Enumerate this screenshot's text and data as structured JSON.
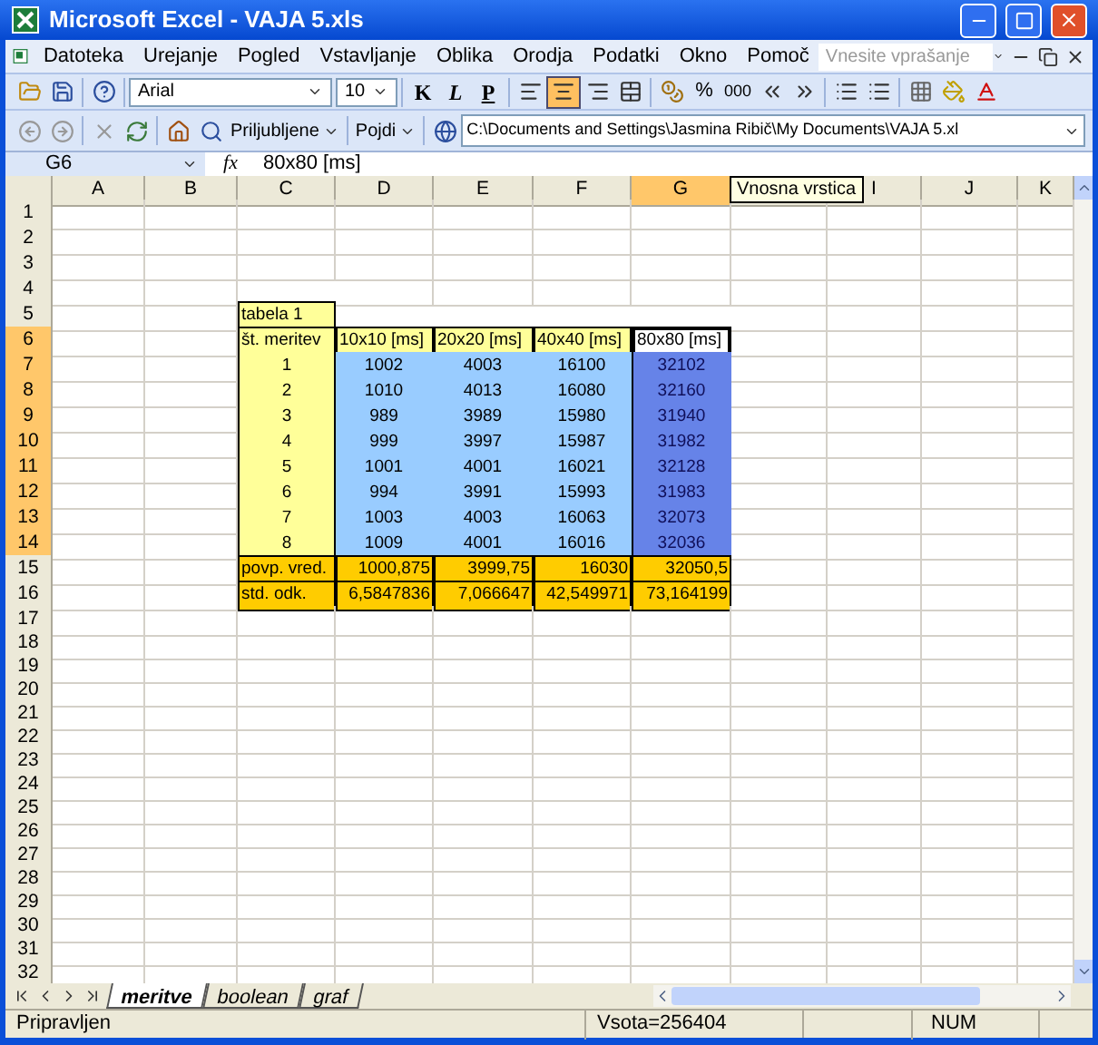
{
  "window": {
    "title": "Microsoft Excel - VAJA 5.xls"
  },
  "menu": [
    "Datoteka",
    "Urejanje",
    "Pogled",
    "Vstavljanje",
    "Oblika",
    "Orodja",
    "Podatki",
    "Okno",
    "Pomoč"
  ],
  "help_search": {
    "placeholder": "Vnesite vprašanje"
  },
  "formatting_toolbar": {
    "font": "Arial",
    "size": "10",
    "bold": "K",
    "italic": "L",
    "underline": "P",
    "percent": "%",
    "thousands": "000",
    "alignments": [
      {
        "kind": "left",
        "selected": false
      },
      {
        "kind": "center",
        "selected": true
      },
      {
        "kind": "right",
        "selected": false
      }
    ]
  },
  "web_toolbar": {
    "favorites": "Priljubljene",
    "go": "Pojdi",
    "address": "C:\\Documents and Settings\\Jasmina Ribič\\My Documents\\VAJA 5.xl"
  },
  "formula_bar": {
    "name_box": "G6",
    "function_label": "fx",
    "content": "80x80 [ms]"
  },
  "tooltip": "Vnosna vrstica",
  "columns": [
    {
      "label": "A",
      "selected": false
    },
    {
      "label": "B",
      "selected": false
    },
    {
      "label": "C",
      "selected": false
    },
    {
      "label": "D",
      "selected": false
    },
    {
      "label": "E",
      "selected": false
    },
    {
      "label": "F",
      "selected": false
    },
    {
      "label": "G",
      "selected": true
    },
    {
      "selected": false
    },
    {
      "label": "I",
      "selected": false
    },
    {
      "label": "J",
      "selected": false
    },
    {
      "label": "K",
      "selected": false
    }
  ],
  "rows": [
    {
      "label": "1",
      "selected": false
    },
    {
      "label": "2",
      "selected": false
    },
    {
      "label": "3",
      "selected": false
    },
    {
      "label": "4",
      "selected": false
    },
    {
      "label": "5",
      "selected": false
    },
    {
      "label": "6",
      "selected": true
    },
    {
      "label": "7",
      "selected": true
    },
    {
      "label": "8",
      "selected": true
    },
    {
      "label": "9",
      "selected": true
    },
    {
      "label": "10",
      "selected": true
    },
    {
      "label": "11",
      "selected": true
    },
    {
      "label": "12",
      "selected": true
    },
    {
      "label": "13",
      "selected": true
    },
    {
      "label": "14",
      "selected": true
    },
    {
      "label": "15",
      "selected": false
    },
    {
      "label": "16",
      "selected": false
    },
    {
      "label": "17",
      "selected": false
    },
    {
      "label": "18",
      "selected": false
    },
    {
      "label": "19",
      "selected": false
    },
    {
      "label": "20",
      "selected": false
    },
    {
      "label": "21",
      "selected": false
    },
    {
      "label": "22",
      "selected": false
    },
    {
      "label": "23",
      "selected": false
    },
    {
      "label": "24",
      "selected": false
    },
    {
      "label": "25",
      "selected": false
    },
    {
      "label": "26",
      "selected": false
    },
    {
      "label": "27",
      "selected": false
    },
    {
      "label": "28",
      "selected": false
    },
    {
      "label": "29",
      "selected": false
    },
    {
      "label": "30",
      "selected": false
    },
    {
      "label": "31",
      "selected": false
    },
    {
      "label": "32",
      "selected": false
    }
  ],
  "table": {
    "title": "tabela 1",
    "label_header": "št. meritev",
    "row_labels": [
      "1",
      "2",
      "3",
      "4",
      "5",
      "6",
      "7",
      "8"
    ],
    "summary_labels": [
      "povp. vred.",
      "std. odk."
    ],
    "columns": [
      {
        "header": "10x10 [ms]",
        "selected": false,
        "values": [
          "1002",
          "1010",
          "989",
          "999",
          "1001",
          "994",
          "1003",
          "1009"
        ],
        "summary": [
          "1000,875",
          "6,5847836"
        ]
      },
      {
        "header": "20x20 [ms]",
        "selected": false,
        "values": [
          "4003",
          "4013",
          "3989",
          "3997",
          "4001",
          "3991",
          "4003",
          "4001"
        ],
        "summary": [
          "3999,75",
          "7,066647"
        ]
      },
      {
        "header": "40x40 [ms]",
        "selected": false,
        "values": [
          "16100",
          "16080",
          "15980",
          "15987",
          "16021",
          "15993",
          "16063",
          "16016"
        ],
        "summary": [
          "16030",
          "42,549971"
        ]
      },
      {
        "header": "80x80 [ms]",
        "selected": true,
        "values": [
          "32102",
          "32160",
          "31940",
          "31982",
          "32128",
          "31983",
          "32073",
          "32036"
        ],
        "summary": [
          "32050,5",
          "73,164199"
        ]
      }
    ]
  },
  "sheet_tabs": [
    {
      "label": "meritve",
      "selected": true
    },
    {
      "label": "boolean",
      "selected": false
    },
    {
      "label": "graf",
      "selected": false
    }
  ],
  "status_bar": {
    "status": "Pripravljen",
    "sum": "Vsota=256404",
    "num": "NUM"
  }
}
